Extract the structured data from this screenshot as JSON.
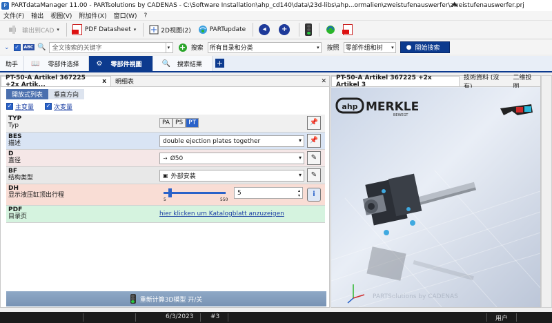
{
  "window": {
    "title": "PARTdataManager 11.00 - PARTsolutions by CADENAS - C:\\Software Installation\\ahp_cd140\\data\\23d-libs\\ahp...ormalien\\zweistufenauswerfer\\zweistufenauswerfer.prj"
  },
  "menu": [
    "文件(F)",
    "输出",
    "视图(V)",
    "附加件(X)",
    "窗口(W)",
    "?"
  ],
  "toolbar": {
    "export_cad": "输出到CAD",
    "pdf_datasheet": "PDF Datasheet",
    "view2d": "2D视图(2)",
    "partupdate": "PARTupdate"
  },
  "search": {
    "abc": "ABC",
    "placeholder": "全文搜索的关键字",
    "search_label": "搜索",
    "scope_value": "所有目录和分类",
    "by_label": "按照",
    "group_value": "零部件组和树",
    "start_button": "開始搜索"
  },
  "main_tabs": {
    "helper": "助手",
    "part_select": "零部件选择",
    "part_view": "零部件視圖",
    "results": "搜索結果"
  },
  "left_panel": {
    "tab_title": "PT-50-A Artikel 367225 +2x Artik...",
    "tab_close": "x",
    "tab_detail": "明细表",
    "sub_tab_table": "開放式列表",
    "sub_tab_vertical": "垂直方向",
    "main_var": "主变量",
    "sub_var": "次变量",
    "rows": [
      {
        "code": "TYP",
        "label": "Typ"
      },
      {
        "code": "BES",
        "label": "描述",
        "value": "double ejection plates together"
      },
      {
        "code": "D",
        "label": "直径",
        "value": "Ø50"
      },
      {
        "code": "BF",
        "label": "结构类型",
        "value": "外部安装"
      },
      {
        "code": "DH",
        "label": "显示液压缸顶出行程",
        "value": "5",
        "slider_min": "5",
        "slider_max": "550",
        "slider_fraction": 0.1
      },
      {
        "code": "PDF",
        "label": "目录页",
        "link": "hier klicken um Katalogblatt anzuzeigen"
      }
    ],
    "typ_options": [
      "PA",
      "PS",
      "PT"
    ],
    "typ_selected": "PT",
    "recalc_label": "重新计算3D模型 开/关"
  },
  "right_panel": {
    "tab_title": "PT-50-A Artikel 367225 +2x Artikel 3",
    "tab_tech": "技術資料 (沒有)",
    "tab_2d": "二维投图",
    "brand_ahp": "ahp",
    "brand_merkle": "MERKLE",
    "brand_sub": "BEWEGT",
    "watermark": "PARTSolutions by CADENAS"
  },
  "statusbar": {
    "date": "6/3/2023",
    "num": "#3",
    "user": "用户"
  },
  "colors": {
    "accent": "#0c3a8e",
    "row_typ": "#f0f0f0",
    "row_bes": "#d9e4f4",
    "row_d": "#f5e7e7",
    "row_bf": "#e8e8e8",
    "row_dh": "#f9ddd5",
    "row_pdf": "#d5f3df"
  }
}
